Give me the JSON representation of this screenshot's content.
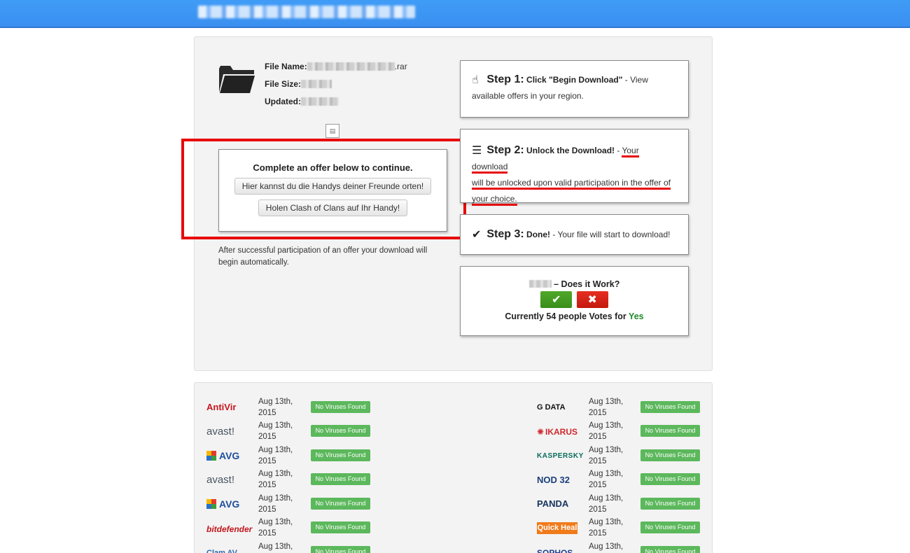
{
  "header": {
    "title_blurred": ""
  },
  "file": {
    "name_label": "File Name:",
    "name_ext": ".rar",
    "size_label": "File Size:",
    "updated_label": "Updated:"
  },
  "offer": {
    "heading": "Complete an offer below to continue.",
    "buttons": [
      "Hier kannst du die Handys deiner Freunde orten!",
      "Holen Clash of Clans auf Ihr Handy!"
    ],
    "after_text": "After successful participation of an offer your download will begin automatically."
  },
  "steps": [
    {
      "number": "Step 1:",
      "title": "Click \"Begin Download\"",
      "desc": " - View available offers in your region.",
      "icon": "pointer-hand-icon"
    },
    {
      "number": "Step 2:",
      "title": "Unlock the Download!",
      "desc_pre": " - ",
      "desc_1": "Your download",
      "desc_2": "will be unlocked upon valid participation in the offer of",
      "desc_3": "your choice.",
      "icon": "server-icon"
    },
    {
      "number": "Step 3:",
      "title": "Done!",
      "desc": " - Your file will start to download!",
      "icon": "checkmark-icon"
    }
  ],
  "vote": {
    "question": "– Does it Work?",
    "yes_symbol": "✔",
    "no_symbol": "✖",
    "count_text": "Currently 54 people Votes for ",
    "count_answer": "Yes"
  },
  "scans": {
    "left": [
      {
        "vendor": "AntiVir",
        "date": "Aug 13th, 2015",
        "status": "No Viruses Found"
      },
      {
        "vendor": "avast!",
        "date": "Aug 13th, 2015",
        "status": "No Viruses Found"
      },
      {
        "vendor": "AVG",
        "date": "Aug 13th, 2015",
        "status": "No Viruses Found"
      },
      {
        "vendor": "avast!",
        "date": "Aug 13th, 2015",
        "status": "No Viruses Found"
      },
      {
        "vendor": "AVG",
        "date": "Aug 13th, 2015",
        "status": "No Viruses Found"
      },
      {
        "vendor": "bitdefender",
        "date": "Aug 13th, 2015",
        "status": "No Viruses Found"
      },
      {
        "vendor": "Clam AV",
        "date": "Aug 13th,",
        "status": "No Viruses Found"
      }
    ],
    "right": [
      {
        "vendor": "G DATA",
        "date": "Aug 13th, 2015",
        "status": "No Viruses Found"
      },
      {
        "vendor": "IKARUS",
        "date": "Aug 13th, 2015",
        "status": "No Viruses Found"
      },
      {
        "vendor": "KASPERSKY",
        "date": "Aug 13th, 2015",
        "status": "No Viruses Found"
      },
      {
        "vendor": "NOD 32",
        "date": "Aug 13th, 2015",
        "status": "No Viruses Found"
      },
      {
        "vendor": "PANDA",
        "date": "Aug 13th, 2015",
        "status": "No Viruses Found"
      },
      {
        "vendor": "Quick Heal",
        "date": "Aug 13th, 2015",
        "status": "No Viruses Found"
      },
      {
        "vendor": "SOPHOS",
        "date": "Aug 13th,",
        "status": "No Viruses Found"
      }
    ]
  },
  "colors": {
    "header": "#3b8ff0",
    "badge": "#5cb85c",
    "highlight": "#e8090c",
    "vote_yes": "#3a8e1b",
    "vote_no": "#c4180e"
  }
}
